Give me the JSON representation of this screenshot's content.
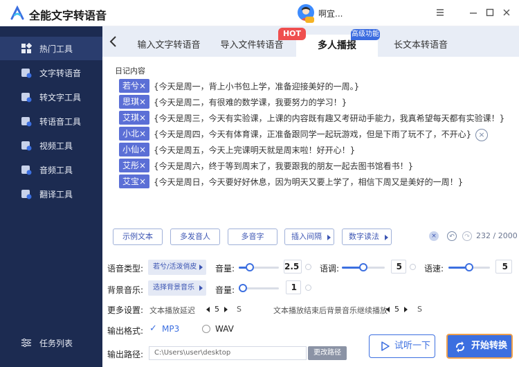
{
  "app": {
    "title": "全能文字转语音",
    "user_name": "啊宜...",
    "window_controls": [
      "menu-icon",
      "minimize-icon",
      "maximize-icon",
      "close-icon"
    ]
  },
  "sidebar": {
    "items": [
      {
        "label": "热门工具",
        "icon": "grid-icon",
        "active": true
      },
      {
        "label": "文字转语音",
        "icon": "text-to-speech-icon",
        "active": false
      },
      {
        "label": "转文字工具",
        "icon": "to-text-icon",
        "active": false
      },
      {
        "label": "转语音工具",
        "icon": "to-speech-icon",
        "active": false
      },
      {
        "label": "视频工具",
        "icon": "video-icon",
        "active": false
      },
      {
        "label": "音频工具",
        "icon": "audio-icon",
        "active": false
      },
      {
        "label": "翻译工具",
        "icon": "translate-icon",
        "active": false
      }
    ],
    "task_list": "任务列表"
  },
  "tabs": {
    "items": [
      {
        "label": "输入文字转语音",
        "active": false
      },
      {
        "label": "导入文件转语音",
        "active": false
      },
      {
        "label": "多人播报",
        "active": true
      },
      {
        "label": "长文本转语音",
        "active": false
      }
    ],
    "hot_badge": "HOT",
    "advanced_badge": "高级功能"
  },
  "content": {
    "label": "日记内容",
    "rows": [
      {
        "speaker": "若兮×",
        "text": "{今天是周一，背上小书包上学，准备迎接美好的一周。}"
      },
      {
        "speaker": "思琪×",
        "text": "{今天是周二，有很难的数学课，我要努力的学习！}"
      },
      {
        "speaker": "艾琪×",
        "text": "{今天是周三，今天有实验课，上课的内容既有趣又考研动手能力，我真希望每天都有实验课！}"
      },
      {
        "speaker": "小北×",
        "text": "{今天是周四，今天有体育课，正准备跟同学一起玩游戏，但是下雨了玩不了，不开心}"
      },
      {
        "speaker": "小仙×",
        "text": "{今天是周五，今天上完课明天就是周末啦！好开心！}"
      },
      {
        "speaker": "艾彤×",
        "text": "{今天是周六，终于等到周末了，我要跟我的朋友一起去图书馆看书！}"
      },
      {
        "speaker": "艾宝×",
        "text": "{今天是周日，今天要好好休息，因为明天又要上学了，相信下周又是美好的一周！}"
      }
    ]
  },
  "toolbar": {
    "example": "示例文本",
    "multi_speaker": "多发音人",
    "polyphone": "多音字",
    "insert_pause": "插入间隔",
    "number_reading": "数字读法",
    "count": "232 / 2000"
  },
  "settings": {
    "voice_type_label": "语音类型:",
    "voice_type_value": "若兮/活泼俏皮",
    "volume_label": "音量:",
    "volume_value": "2.5",
    "volume_level": 0.28,
    "pitch_label": "语调:",
    "pitch_value": "5",
    "pitch_level": 0.5,
    "speed_label": "语速:",
    "speed_value": "5",
    "speed_level": 0.5,
    "bgm_label": "背景音乐:",
    "bgm_value": "选择背景音乐",
    "bgm_volume_label": "音量:",
    "bgm_volume_value": "1",
    "bgm_volume_level": 0.1,
    "more_label": "更多设置:",
    "delay_label": "文本播放延迟",
    "delay_value": "5",
    "delay_unit": "S",
    "bgm_continue_label": "文本播放结束后背景音乐继续播放",
    "bgm_continue_value": "5",
    "bgm_continue_unit": "S",
    "format_label": "输出格式:",
    "format_mp3": "MP3",
    "format_wav": "WAV",
    "format_selected": "MP3",
    "path_label": "输出路径:",
    "path_value": "C:\\Users\\user\\desktop",
    "change_path": "更改路径"
  },
  "actions": {
    "listen": "试听一下",
    "start": "开始转换"
  },
  "colors": {
    "sidebar": "#1c2b51",
    "accent": "#3c6fe0",
    "speaker_tag": "#5b6fd6",
    "hot": "#ef4f4f",
    "start_border": "#f0a04a"
  }
}
